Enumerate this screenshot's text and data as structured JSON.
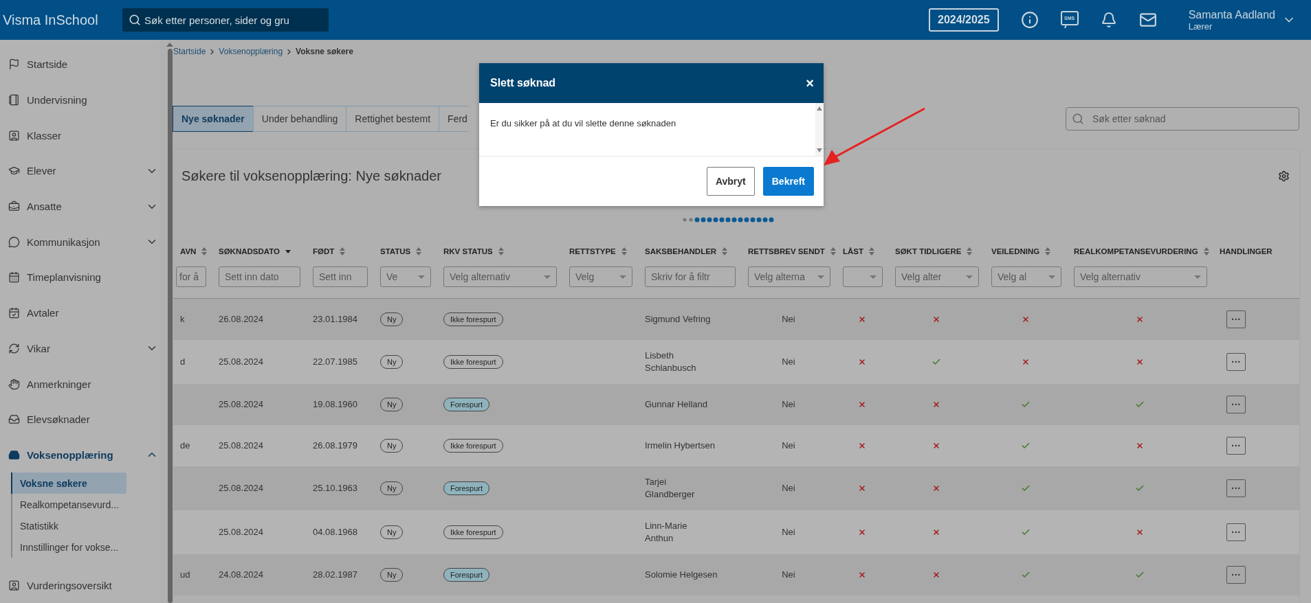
{
  "topbar": {
    "logo": "Visma InSchool",
    "search": {
      "placeholder": "Søk etter personer, sider og gru"
    },
    "year": "2024/2025",
    "sms_label": "SMS",
    "user": {
      "name": "Samanta Aadland",
      "role": "Lærer"
    }
  },
  "sidebar": {
    "items": [
      {
        "label": "Startside",
        "kind": "flag"
      },
      {
        "label": "Undervisning",
        "kind": "book"
      },
      {
        "label": "Klasser",
        "kind": "board"
      },
      {
        "label": "Elever",
        "kind": "student",
        "expanded": false
      },
      {
        "label": "Ansatte",
        "kind": "briefcase",
        "expanded": false
      },
      {
        "label": "Kommunikasjon",
        "kind": "chat",
        "expanded": false
      },
      {
        "label": "Timeplanvisning",
        "kind": "calendar"
      },
      {
        "label": "Avtaler",
        "kind": "appointment"
      },
      {
        "label": "Vikar",
        "kind": "refresh",
        "expanded": false
      },
      {
        "label": "Anmerkninger",
        "kind": "hand"
      },
      {
        "label": "Elevsøknader",
        "kind": "inbox"
      },
      {
        "label": "Voksenopplæring",
        "kind": "tray",
        "expanded": true,
        "active": true,
        "children": [
          {
            "label": "Voksne søkere",
            "selected": true
          },
          {
            "label": "Realkompetansevurd...",
            "selected": false
          },
          {
            "label": "Statistikk",
            "selected": false
          },
          {
            "label": "Innstillinger for vokse...",
            "selected": false
          }
        ]
      },
      {
        "label": "Vurderingsoversikt",
        "kind": "board"
      }
    ]
  },
  "breadcrumb": [
    {
      "label": "Startside",
      "link": true
    },
    {
      "label": "Voksenopplæring",
      "link": true
    },
    {
      "label": "Voksne søkere",
      "link": false
    }
  ],
  "tabs": [
    {
      "label": "Nye søknader",
      "selected": true
    },
    {
      "label": "Under behandling",
      "selected": false
    },
    {
      "label": "Rettighet bestemt",
      "selected": false
    },
    {
      "label": "Ferd",
      "selected": false
    }
  ],
  "search": {
    "placeholder": "Søk etter søknad"
  },
  "card": {
    "title": "Søkere til voksenopplæring: Nye søknader"
  },
  "table": {
    "columns": [
      {
        "label": "AVN",
        "sorted": false,
        "filter": {
          "kind": "text",
          "placeholder": "for å"
        }
      },
      {
        "label": "SØKNADSDATO",
        "sorted": true,
        "filter": {
          "kind": "text",
          "placeholder": "Sett inn dato"
        }
      },
      {
        "label": "FØDT",
        "sorted": false,
        "filter": {
          "kind": "text",
          "placeholder": "Sett inn"
        }
      },
      {
        "label": "STATUS",
        "sorted": false,
        "filter": {
          "kind": "select",
          "placeholder": "Ve"
        }
      },
      {
        "label": "RKV STATUS",
        "sorted": false,
        "filter": {
          "kind": "select",
          "placeholder": "Velg alternativ"
        }
      },
      {
        "label": "RETTSTYPE",
        "sorted": false,
        "filter": {
          "kind": "select",
          "placeholder": "Velg"
        }
      },
      {
        "label": "SAKSBEHANDLER",
        "sorted": false,
        "filter": {
          "kind": "text",
          "placeholder": "Skriv for å filtr"
        }
      },
      {
        "label": "RETTSBREV SENDT",
        "sorted": false,
        "filter": {
          "kind": "select",
          "placeholder": "Velg alterna"
        }
      },
      {
        "label": "LÅST",
        "sorted": false,
        "filter": {
          "kind": "select"
        }
      },
      {
        "label": "SØKT TIDLIGERE",
        "sorted": false,
        "filter": {
          "kind": "select",
          "placeholder": "Velg alter"
        }
      },
      {
        "label": "VEILEDNING",
        "sorted": false,
        "filter": {
          "kind": "select",
          "placeholder": "Velg al"
        }
      },
      {
        "label": "REALKOMPETANSEVURDERING",
        "sorted": false,
        "filter": {
          "kind": "select",
          "placeholder": "Velg alternativ"
        }
      },
      {
        "label": "HANDLINGER"
      }
    ],
    "rows": [
      {
        "name": "k",
        "date": "26.08.2024",
        "born": "23.01.1984",
        "status": "Ny",
        "rkv": {
          "label": "Ikke forespurt",
          "requested": false
        },
        "handler": "Sigmund Vefring",
        "letter": "Nei",
        "locked": false,
        "applied_before": false,
        "guidance": false,
        "assessment": false,
        "action": "···"
      },
      {
        "name": "d",
        "date": "25.08.2024",
        "born": "22.07.1985",
        "status": "Ny",
        "rkv": {
          "label": "Ikke forespurt",
          "requested": false
        },
        "handler": "Lisbeth\nSchlanbusch",
        "letter": "Nei",
        "locked": false,
        "applied_before": true,
        "guidance": false,
        "assessment": false,
        "action": "···"
      },
      {
        "date": "25.08.2024",
        "born": "19.08.1960",
        "status": "Ny",
        "rkv": {
          "label": "Forespurt",
          "requested": true
        },
        "handler": "Gunnar Helland",
        "letter": "Nei",
        "locked": false,
        "applied_before": false,
        "guidance": true,
        "assessment": true,
        "action": "···"
      },
      {
        "name": "de",
        "date": "25.08.2024",
        "born": "26.08.1979",
        "status": "Ny",
        "rkv": {
          "label": "Ikke forespurt",
          "requested": false
        },
        "handler": "Irmelin Hybertsen",
        "letter": "Nei",
        "locked": false,
        "applied_before": false,
        "guidance": true,
        "assessment": false,
        "action": "···"
      },
      {
        "date": "25.08.2024",
        "born": "25.10.1963",
        "status": "Ny",
        "rkv": {
          "label": "Forespurt",
          "requested": true
        },
        "handler": "Tarjei\nGlandberger",
        "letter": "Nei",
        "locked": false,
        "applied_before": false,
        "guidance": true,
        "assessment": true,
        "action": "···"
      },
      {
        "date": "25.08.2024",
        "born": "04.08.1968",
        "status": "Ny",
        "rkv": {
          "label": "Ikke forespurt",
          "requested": false
        },
        "handler": "Linn-Marie\nAnthun",
        "letter": "Nei",
        "locked": false,
        "applied_before": false,
        "guidance": true,
        "assessment": false,
        "action": "···"
      },
      {
        "name": "ud",
        "date": "24.08.2024",
        "born": "28.02.1987",
        "status": "Ny",
        "rkv": {
          "label": "Forespurt",
          "requested": true
        },
        "handler": "Solomie Helgesen",
        "letter": "Nei",
        "locked": false,
        "applied_before": false,
        "guidance": true,
        "assessment": true,
        "action": "···"
      }
    ]
  },
  "dialog": {
    "title": "Slett søknad",
    "close": "×",
    "message": "Er du sikker på at du vil slette denne søknaden",
    "buttons": [
      {
        "label": "Avbryt",
        "kind": "secondary"
      },
      {
        "label": "Bekreft",
        "kind": "primary"
      }
    ]
  }
}
